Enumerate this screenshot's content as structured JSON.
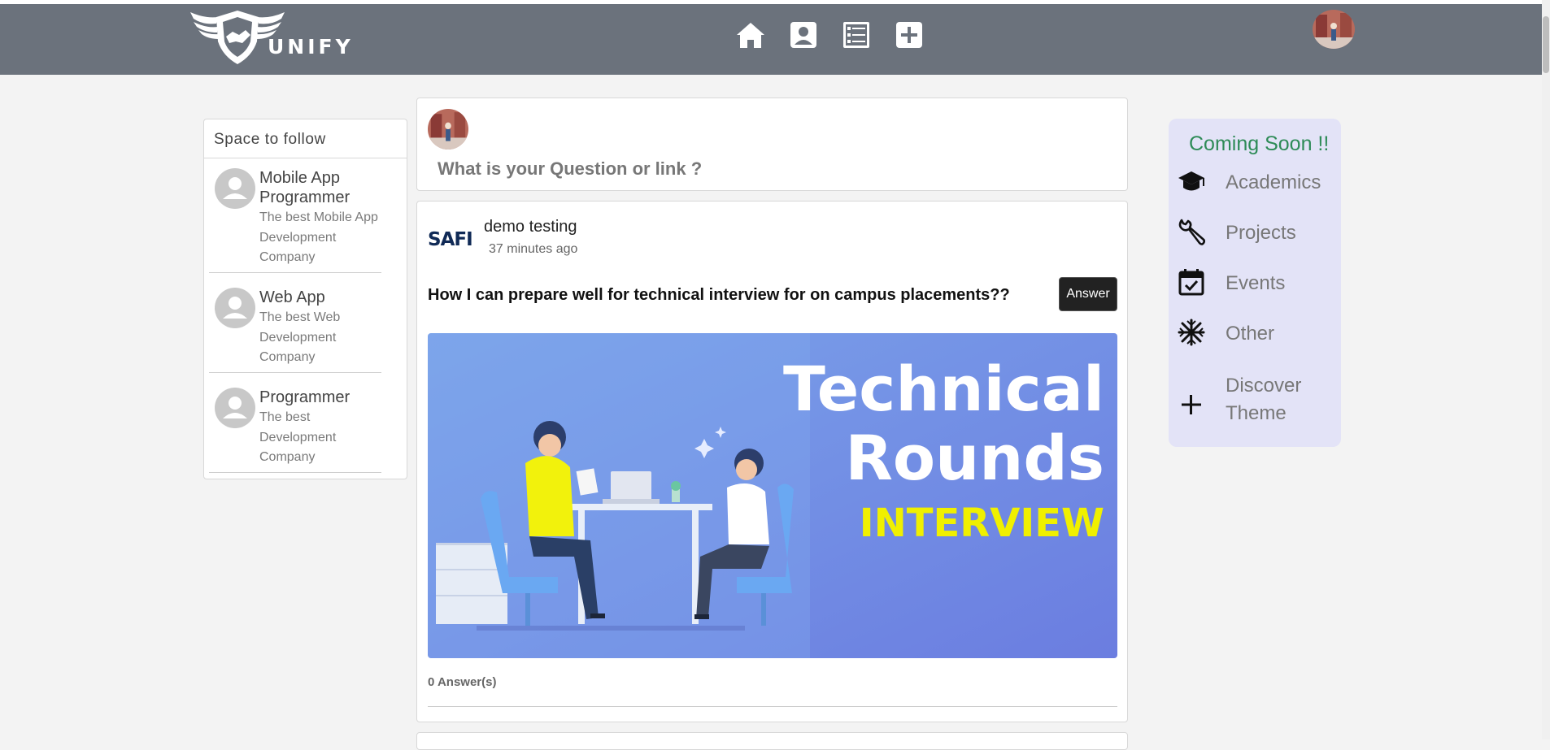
{
  "header": {
    "brand": "UNIFY",
    "nav_icons": [
      "home-icon",
      "profile-icon",
      "list-icon",
      "add-icon"
    ]
  },
  "left_panel": {
    "title": "Space to follow",
    "items": [
      {
        "name": "Mobile App Programmer",
        "desc": "The best Mobile App Development Company"
      },
      {
        "name": "Web App",
        "desc": "The best Web Development Company"
      },
      {
        "name": "Programmer",
        "desc": "The best Development Company"
      }
    ]
  },
  "ask": {
    "placeholder": "What is your Question or link ?"
  },
  "post": {
    "logo_text": "SAFI",
    "user": "demo testing",
    "time": "37 minutes ago",
    "question": "How I can prepare well for technical interview for on campus placements??",
    "answer_button": "Answer",
    "image_text": {
      "line1": "Technical",
      "line2": "Rounds",
      "line3": "INTERVIEW"
    },
    "answers_count": "0 Answer(s)"
  },
  "right_panel": {
    "title": "Coming Soon !!",
    "items": [
      {
        "icon": "graduation-cap-icon",
        "label": "Academics"
      },
      {
        "icon": "wrench-icon",
        "label": "Projects"
      },
      {
        "icon": "calendar-check-icon",
        "label": "Events"
      },
      {
        "icon": "snowflake-icon",
        "label": "Other"
      },
      {
        "icon": "plus-icon",
        "label": "Discover Theme"
      }
    ]
  },
  "colors": {
    "navbar": "#6b727c",
    "page_bg": "#f3f3f3",
    "theme_panel": "#e3e3f7",
    "coming_soon": "#2e8b57",
    "image_bg": "#6b86e0",
    "image_accent": "#f0f000"
  }
}
